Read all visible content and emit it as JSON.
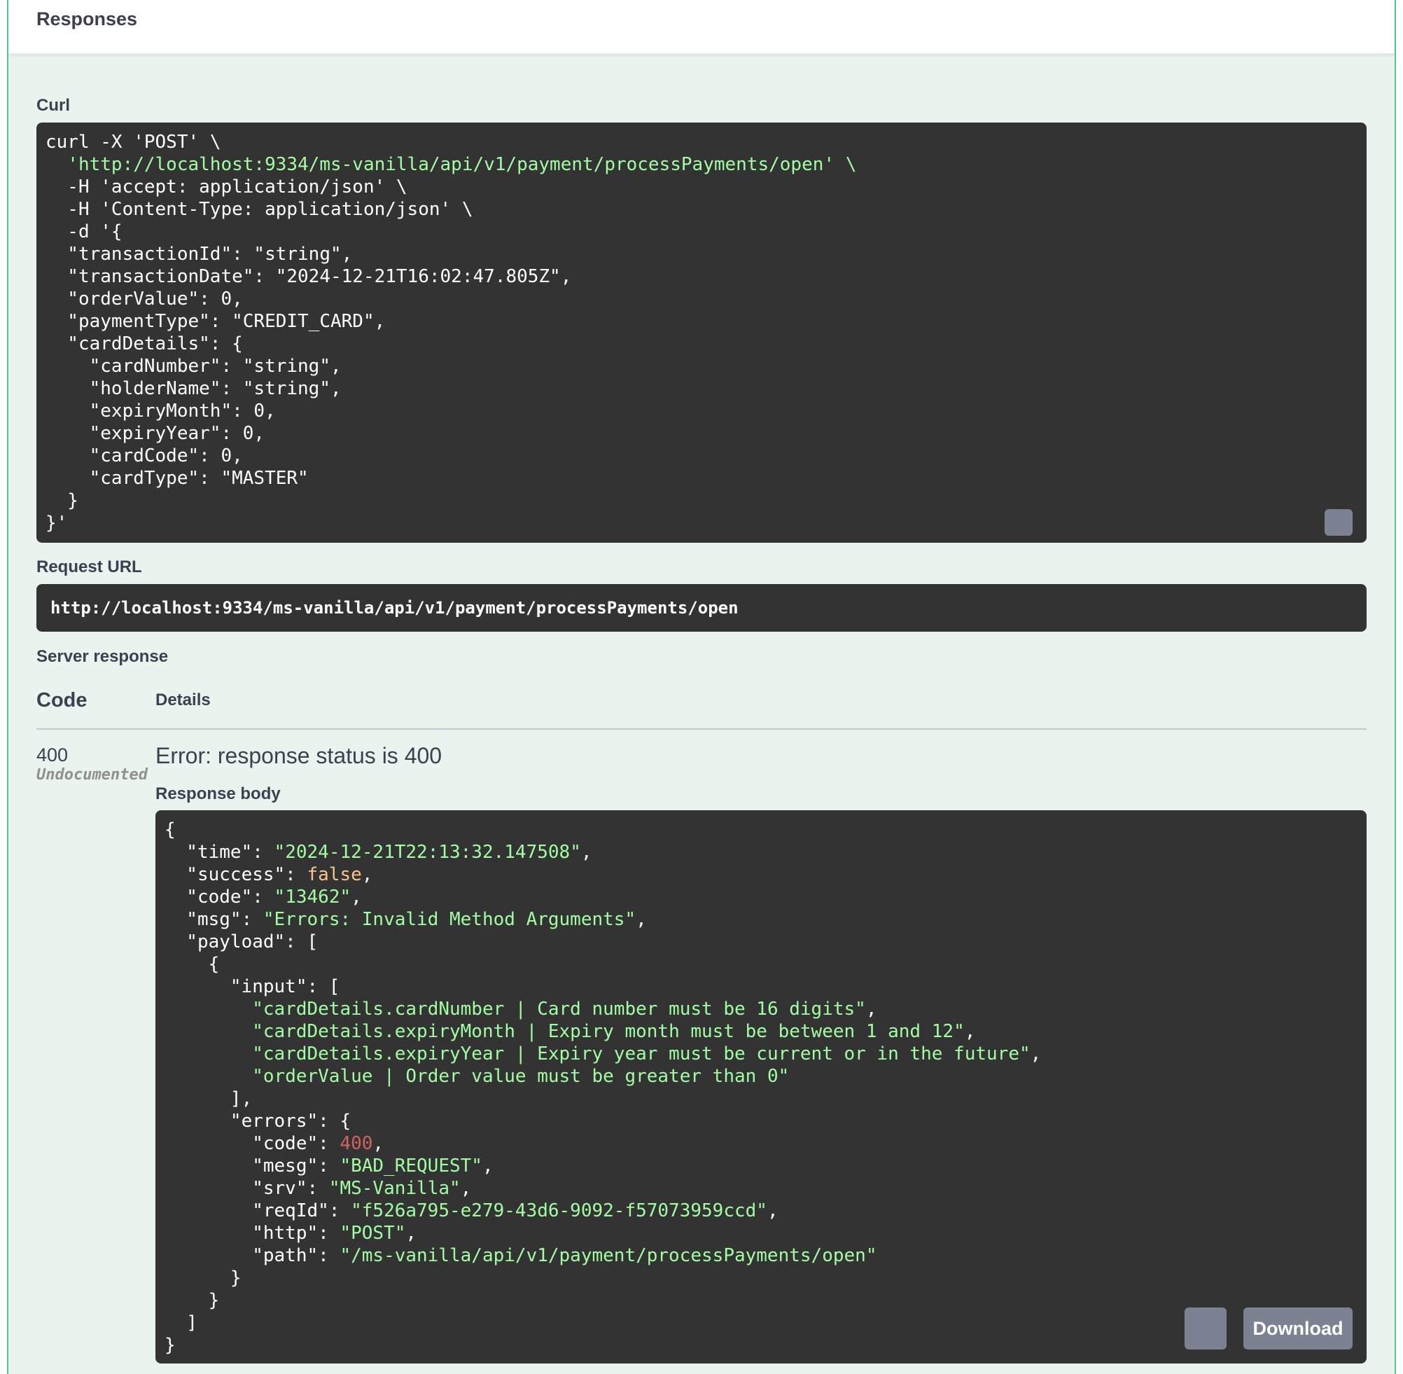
{
  "responses": {
    "title": "Responses"
  },
  "curl": {
    "label": "Curl",
    "lines": [
      "curl -X 'POST' \\",
      "  'http://localhost:9334/ms-vanilla/api/v1/payment/processPayments/open' \\",
      "  -H 'accept: application/json' \\",
      "  -H 'Content-Type: application/json' \\",
      "  -d '{",
      "  \"transactionId\": \"string\",",
      "  \"transactionDate\": \"2024-12-21T16:02:47.805Z\",",
      "  \"orderValue\": 0,",
      "  \"paymentType\": \"CREDIT_CARD\",",
      "  \"cardDetails\": {",
      "    \"cardNumber\": \"string\",",
      "    \"holderName\": \"string\",",
      "    \"expiryMonth\": 0,",
      "    \"expiryYear\": 0,",
      "    \"cardCode\": 0,",
      "    \"cardType\": \"MASTER\"",
      "  }",
      "}'"
    ]
  },
  "request_url": {
    "label": "Request URL",
    "value": "http://localhost:9334/ms-vanilla/api/v1/payment/processPayments/open"
  },
  "server_response": {
    "label": "Server response",
    "col_code": "Code",
    "col_details": "Details",
    "status_code": "400",
    "status_note": "Undocumented",
    "error_title": "Error: response status is 400",
    "body_label": "Response body",
    "download_label": "Download",
    "body": {
      "time": "2024-12-21T22:13:32.147508",
      "success": "false",
      "code": "13462",
      "msg": "Errors: Invalid Method Arguments",
      "input": [
        "cardDetails.cardNumber | Card number must be 16 digits",
        "cardDetails.expiryMonth | Expiry month must be between 1 and 12",
        "cardDetails.expiryYear | Expiry year must be current or in the future",
        "orderValue | Order value must be greater than 0"
      ],
      "errors": {
        "code": "400",
        "mesg": "BAD_REQUEST",
        "srv": "MS-Vanilla",
        "reqId": "f526a795-e279-43d6-9092-f57073959ccd",
        "http": "POST",
        "path": "/ms-vanilla/api/v1/payment/processPayments/open"
      }
    }
  }
}
